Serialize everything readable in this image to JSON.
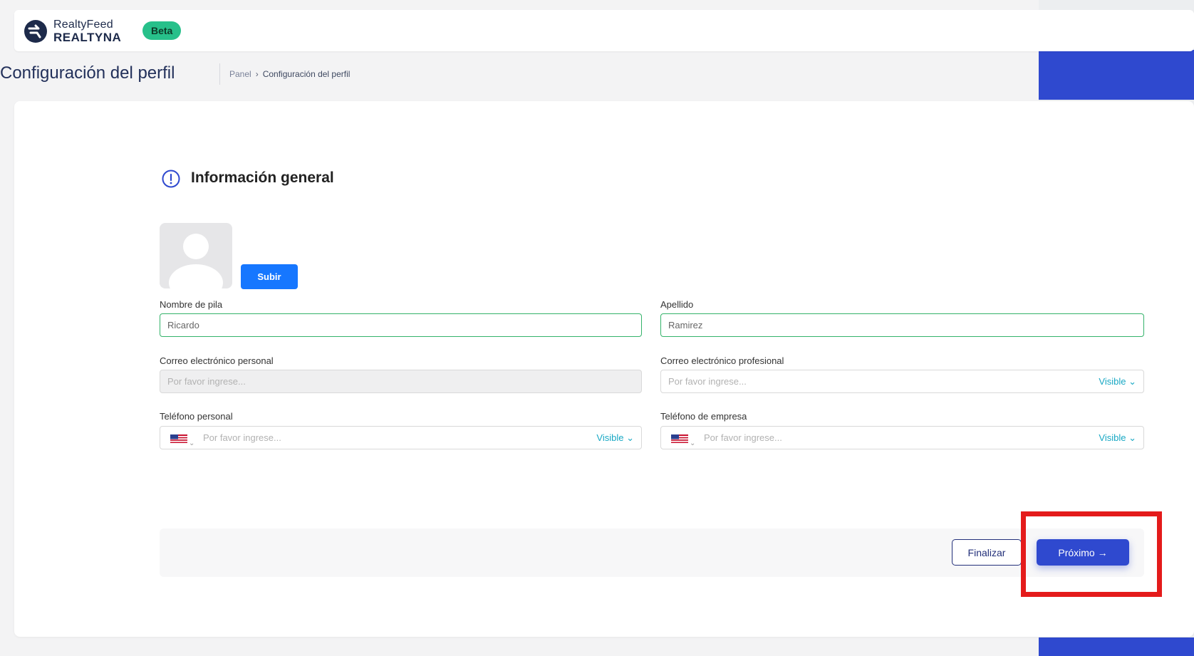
{
  "header": {
    "logo_line1": "RealtyFeed",
    "logo_line2": "REALTYNA",
    "badge": "Beta"
  },
  "title_row": {
    "title": "Configuración del perfil",
    "breadcrumb_home": "Panel",
    "breadcrumb_sep": "›",
    "breadcrumb_current": "Configuración del perfil"
  },
  "section": {
    "title": "Información general",
    "upload_label": "Subir"
  },
  "fields": {
    "first_name": {
      "label": "Nombre de pila",
      "value": "Ricardo"
    },
    "last_name": {
      "label": "Apellido",
      "value": "Ramirez"
    },
    "personal_email": {
      "label": "Correo electrónico personal",
      "placeholder": "Por favor ingrese..."
    },
    "work_email": {
      "label": "Correo electrónico profesional",
      "placeholder": "Por favor ingrese...",
      "visibility": "Visible ⌄"
    },
    "personal_phone": {
      "label": "Teléfono personal",
      "placeholder": "Por favor ingrese...",
      "visibility": "Visible ⌄"
    },
    "work_phone": {
      "label": "Teléfono de empresa",
      "placeholder": "Por favor ingrese...",
      "visibility": "Visible ⌄"
    }
  },
  "footer": {
    "finish_label": "Finalizar",
    "next_label": "Próximo →"
  },
  "colors": {
    "brand_blue": "#2f49cf",
    "badge_green": "#27c08a",
    "upload_blue": "#1677ff",
    "highlight_red": "#e41b1b",
    "visible_teal": "#18a8c4"
  }
}
